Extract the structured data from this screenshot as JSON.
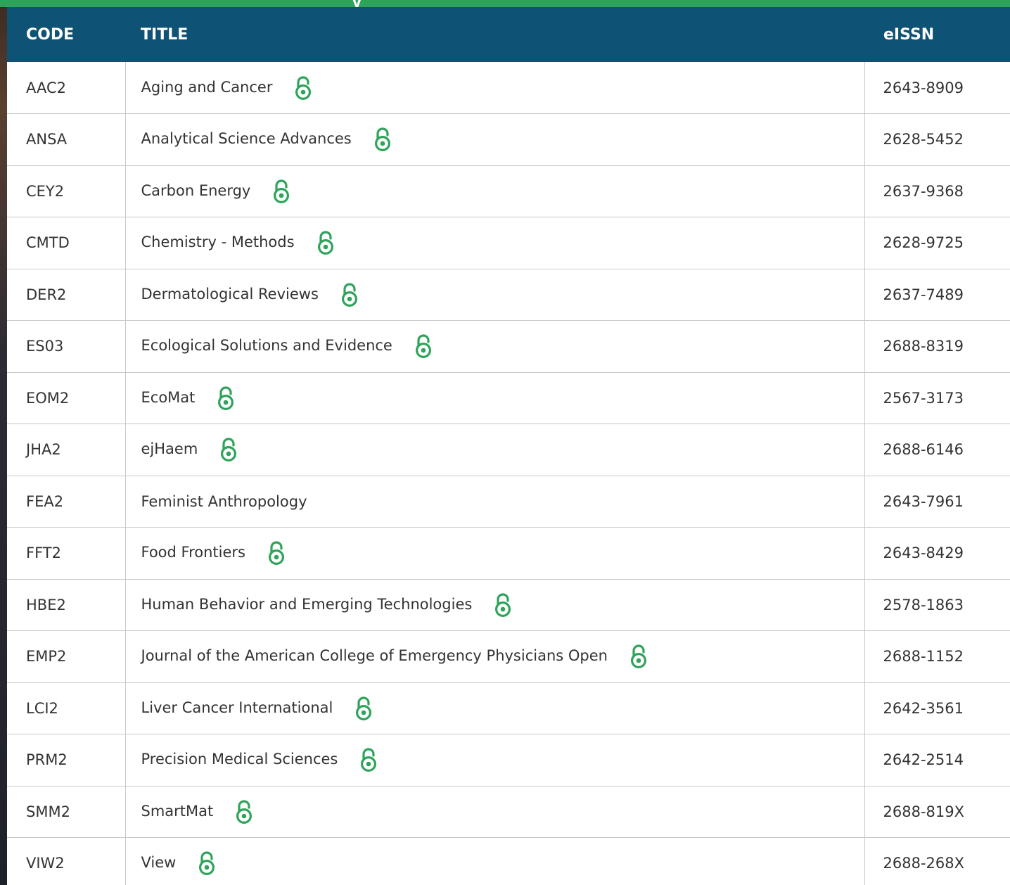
{
  "header_band": {
    "title": "y"
  },
  "table": {
    "columns": {
      "code": "CODE",
      "title": "TITLE",
      "eissn": "eISSN"
    },
    "rows": [
      {
        "code": "AAC2",
        "title": "Aging and Cancer",
        "eissn": "2643-8909",
        "open_access": true
      },
      {
        "code": "ANSA",
        "title": "Analytical Science Advances",
        "eissn": "2628-5452",
        "open_access": true
      },
      {
        "code": "CEY2",
        "title": "Carbon Energy",
        "eissn": "2637-9368",
        "open_access": true
      },
      {
        "code": "CMTD",
        "title": "Chemistry - Methods",
        "eissn": "2628-9725",
        "open_access": true
      },
      {
        "code": "DER2",
        "title": "Dermatological Reviews",
        "eissn": "2637-7489",
        "open_access": true
      },
      {
        "code": "ES03",
        "title": "Ecological Solutions and Evidence",
        "eissn": "2688-8319",
        "open_access": true
      },
      {
        "code": "EOM2",
        "title": "EcoMat",
        "eissn": "2567-3173",
        "open_access": true
      },
      {
        "code": "JHA2",
        "title": "ejHaem",
        "eissn": "2688-6146",
        "open_access": true
      },
      {
        "code": "FEA2",
        "title": "Feminist Anthropology",
        "eissn": "2643-7961",
        "open_access": false
      },
      {
        "code": "FFT2",
        "title": "Food Frontiers",
        "eissn": "2643-8429",
        "open_access": true
      },
      {
        "code": "HBE2",
        "title": "Human Behavior and Emerging Technologies",
        "eissn": "2578-1863",
        "open_access": true
      },
      {
        "code": "EMP2",
        "title": "Journal of the American College of Emergency Physicians Open",
        "eissn": "2688-1152",
        "open_access": true
      },
      {
        "code": "LCI2",
        "title": "Liver Cancer International",
        "eissn": "2642-3561",
        "open_access": true
      },
      {
        "code": "PRM2",
        "title": "Precision Medical Sciences",
        "eissn": "2642-2514",
        "open_access": true
      },
      {
        "code": "SMM2",
        "title": "SmartMat",
        "eissn": "2688-819X",
        "open_access": true
      },
      {
        "code": "VIW2",
        "title": "View",
        "eissn": "2688-268X",
        "open_access": true
      }
    ]
  },
  "icons": {
    "open_access": "open-access-lock-icon"
  },
  "colors": {
    "header_bg": "#0e5275",
    "accent_green": "#2ea35a",
    "open_access_icon": "#2ea35a",
    "cell_text": "#333333",
    "grid_line": "#c9c9c9"
  }
}
